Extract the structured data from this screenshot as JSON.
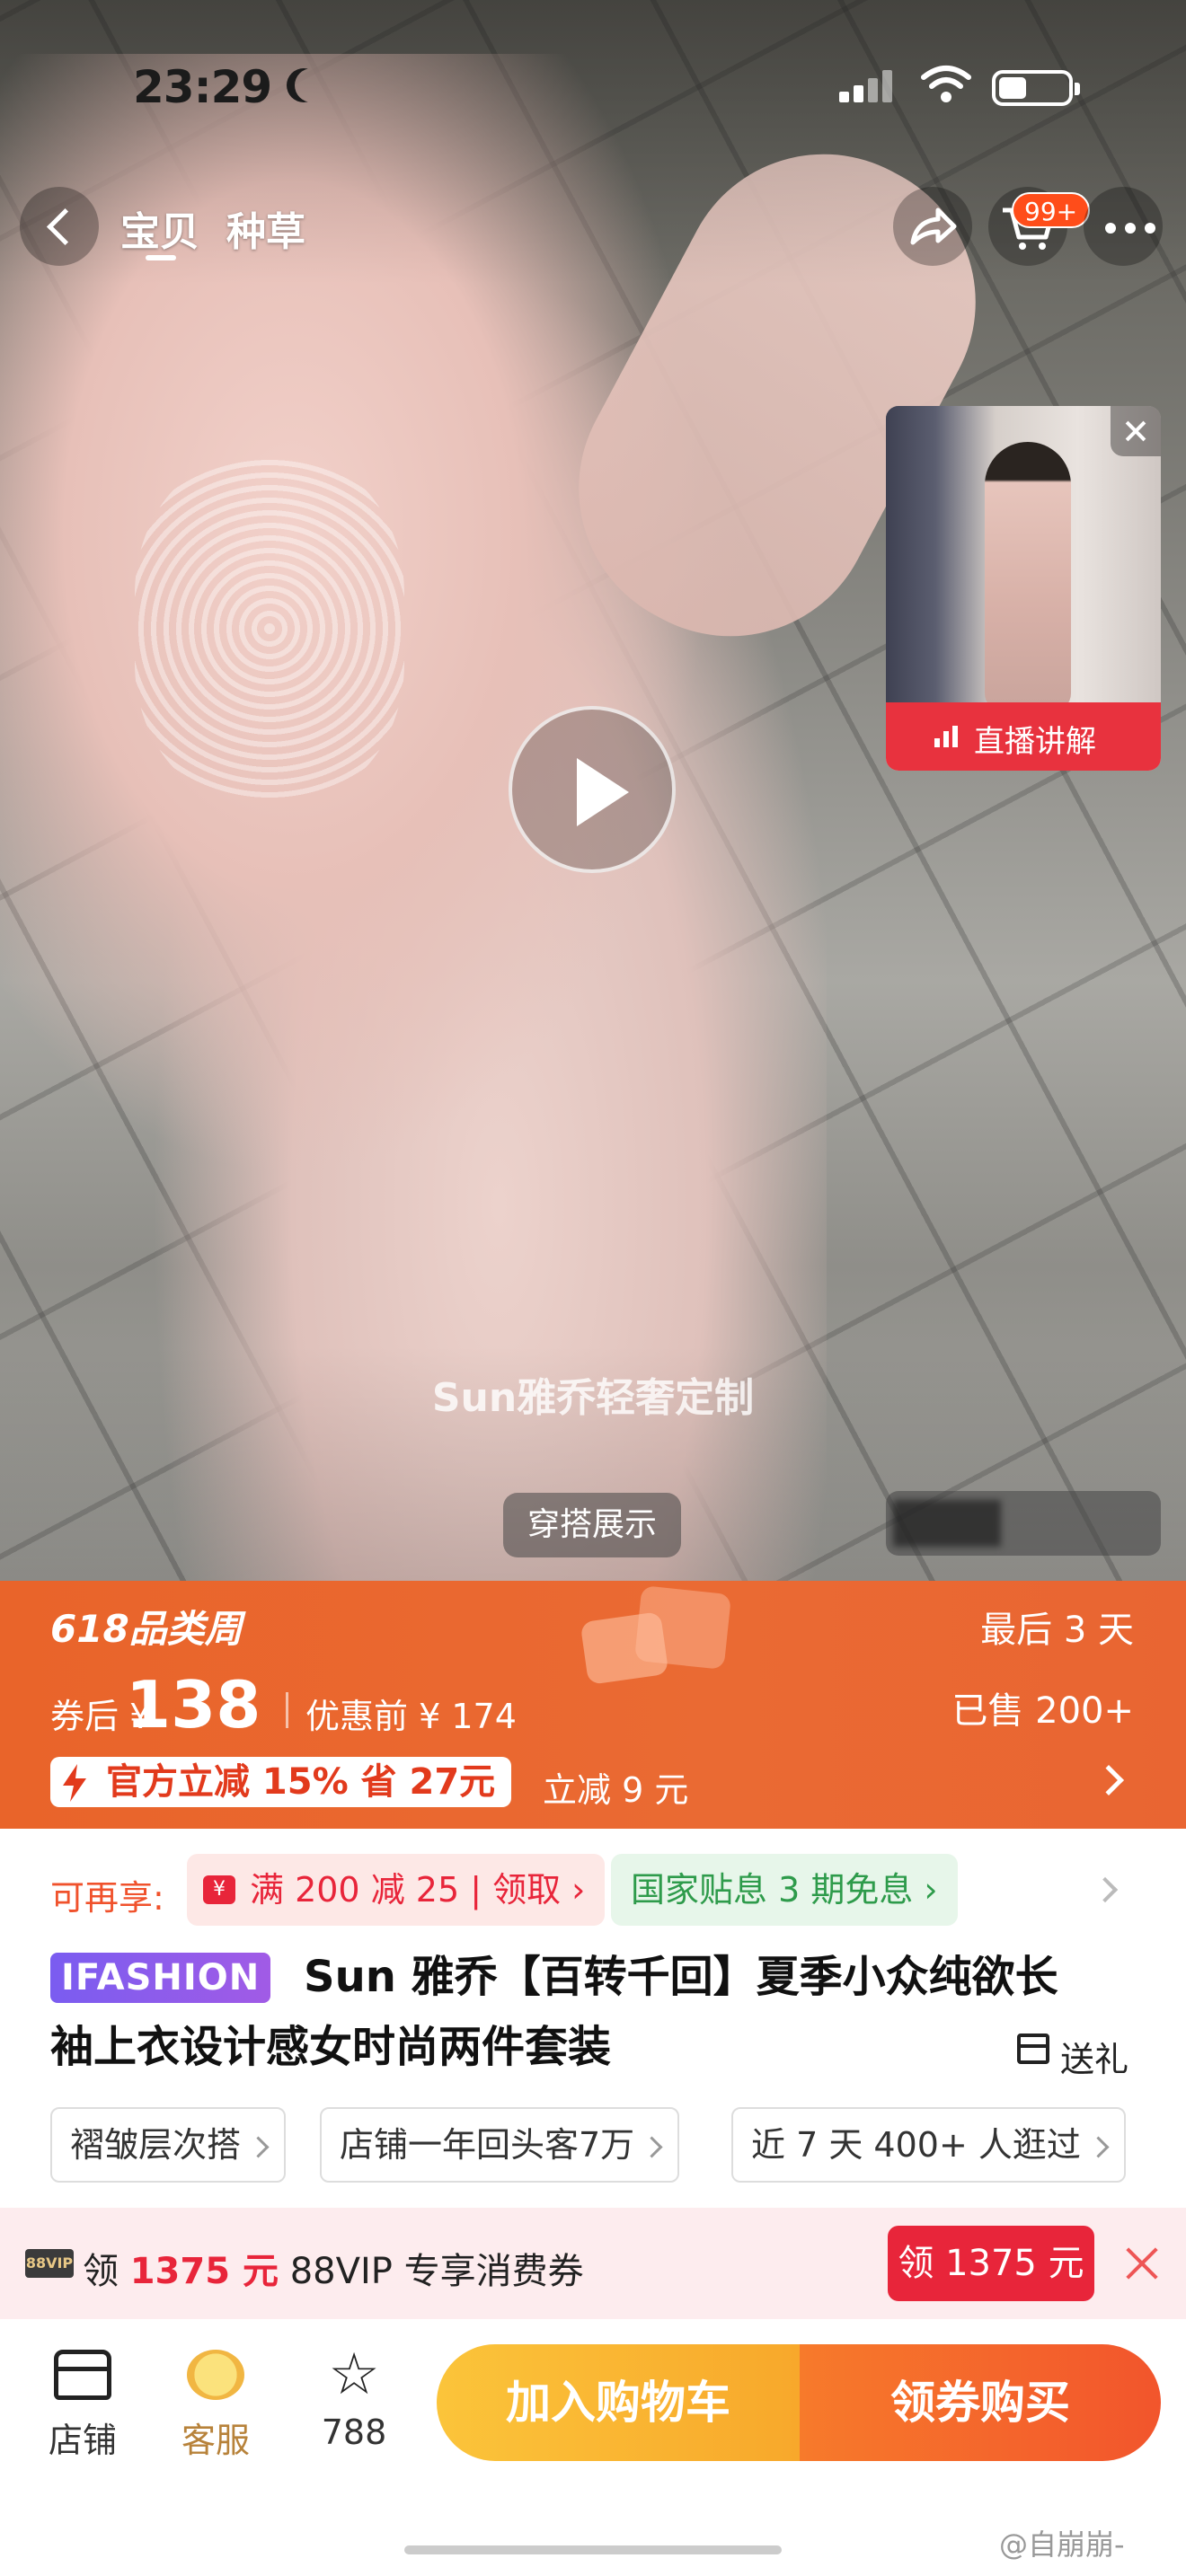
{
  "status_bar": {
    "time": "23:29"
  },
  "nav": {
    "tabs": [
      {
        "label": "宝贝",
        "active": true
      },
      {
        "label": "种草",
        "active": false
      }
    ],
    "cart_badge": "99+"
  },
  "video": {
    "live_label": "直播讲解",
    "watermark": "Sun雅乔轻奢定制",
    "outfit_chip": "穿搭展示"
  },
  "promo": {
    "title": "618品类周",
    "countdown": "最后 3 天",
    "price_label": "券后 ¥",
    "price": "138",
    "price_before": "优惠前 ¥ 174",
    "sold": "已售 200+",
    "discount": "官方立减 15% 省 27元",
    "reduce": "立减 9 元"
  },
  "coupons": {
    "lead": "可再享:",
    "store_coupon": "满 200 减 25 | 领取 ›",
    "gov_subsidy": "国家贴息 3 期免息 ›",
    "yen_icon": "¥"
  },
  "product": {
    "brand": "IFASHION",
    "title_line1": "Sun 雅乔【百转千回】夏季小众纯欲长",
    "title_line2": "袖上衣设计感女时尚两件套装",
    "gift": "送礼",
    "tags": [
      "褶皱层次搭",
      "店铺一年回头客7万",
      "近 7 天 400+ 人逛过"
    ]
  },
  "vip": {
    "logo": "88VIP",
    "text_prefix": "领 ",
    "amount": "1375 元",
    "text_suffix": " 88VIP 专享消费券",
    "button": "领 1375 元"
  },
  "bottom_bar": {
    "store": "店铺",
    "service": "客服",
    "favorites": "788",
    "add_cart": "加入购物车",
    "buy": "领券购买"
  },
  "watermark_credit": "@自崩崩-",
  "colors": {
    "promo_orange": "#e9642a",
    "coupon_red": "#e8253a",
    "subsidy_green": "#2e9b4b",
    "cta_yellow": "#fbc43a",
    "cta_orange": "#f2552c",
    "brand_purple": "#7a5cf0"
  },
  "icons": [
    "moon-icon",
    "signal-icon",
    "wifi-icon",
    "battery-icon",
    "back-icon",
    "share-icon",
    "cart-icon",
    "more-icon",
    "close-icon",
    "play-icon",
    "bolt-icon",
    "gift-icon",
    "store-icon",
    "service-icon",
    "star-icon"
  ]
}
